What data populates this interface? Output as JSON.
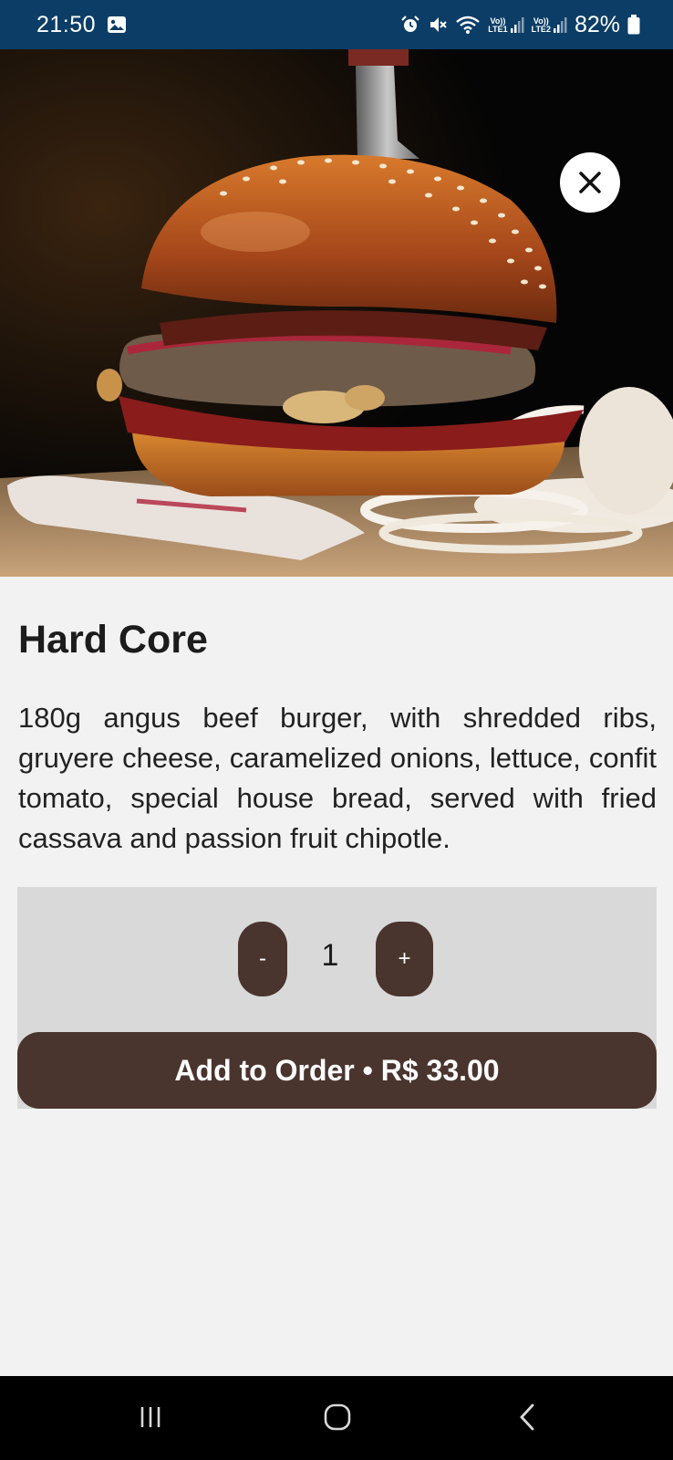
{
  "status_bar": {
    "time": "21:50",
    "left_icon": "image-icon",
    "right_icons": [
      "alarm-icon",
      "mute-icon",
      "wifi-icon",
      "signal-sim1-icon",
      "signal-sim2-icon",
      "battery-icon"
    ],
    "sim1_label_top": "Vo))",
    "sim1_label_bottom": "LTE1",
    "sim2_label_top": "Vo))",
    "sim2_label_bottom": "LTE2",
    "battery": "82%"
  },
  "hero": {
    "image": "burger-photo",
    "close_icon": "close-icon"
  },
  "product": {
    "title": "Hard Core",
    "description": "180g angus beef burger, with shredded ribs, gruyere cheese, caramelized onions, lettuce, confit tomato, special house bread, served with fried cassava and passion fruit chipotle."
  },
  "order": {
    "decrement_label": "-",
    "quantity": "1",
    "increment_label": "+",
    "add_button_label": "Add to Order • R$ 33.00"
  },
  "nav_bar": {
    "icons": [
      "recent-apps-icon",
      "home-icon",
      "back-icon"
    ]
  },
  "colors": {
    "status_bar": "#0b3d66",
    "background": "#f2f2f2",
    "panel": "#d9d9d9",
    "accent_brown": "#4a342e",
    "nav_bar": "#000000"
  }
}
